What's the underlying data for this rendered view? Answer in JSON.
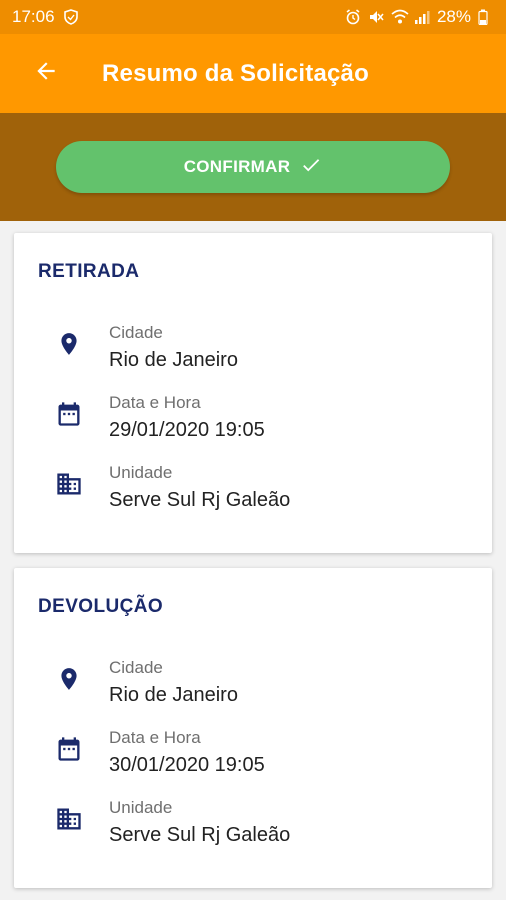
{
  "status_bar": {
    "time": "17:06",
    "battery": "28%",
    "icons": [
      "shield-icon",
      "alarm-icon",
      "mute-icon",
      "wifi-icon",
      "signal-icon",
      "battery-icon"
    ]
  },
  "app_bar": {
    "title": "Resumo da Solicitação",
    "back_icon": "arrow-back-icon"
  },
  "confirm": {
    "label": "CONFIRMAR",
    "icon": "check-icon"
  },
  "colors": {
    "app_bar": "#ff9800",
    "status_bar": "#ee8d00",
    "band": "#a0620a",
    "confirm_button": "#63c26c",
    "title_text": "#1b2a6b",
    "icon": "#1b2a6b"
  },
  "retirada": {
    "title": "RETIRADA",
    "city_label": "Cidade",
    "city": "Rio de Janeiro",
    "datetime_label": "Data e Hora",
    "datetime": "29/01/2020 19:05",
    "unit_label": "Unidade",
    "unit": "Serve Sul Rj Galeão"
  },
  "devolucao": {
    "title": "DEVOLUÇÃO",
    "city_label": "Cidade",
    "city": "Rio de Janeiro",
    "datetime_label": "Data e Hora",
    "datetime": "30/01/2020 19:05",
    "unit_label": "Unidade",
    "unit": "Serve Sul Rj Galeão"
  }
}
